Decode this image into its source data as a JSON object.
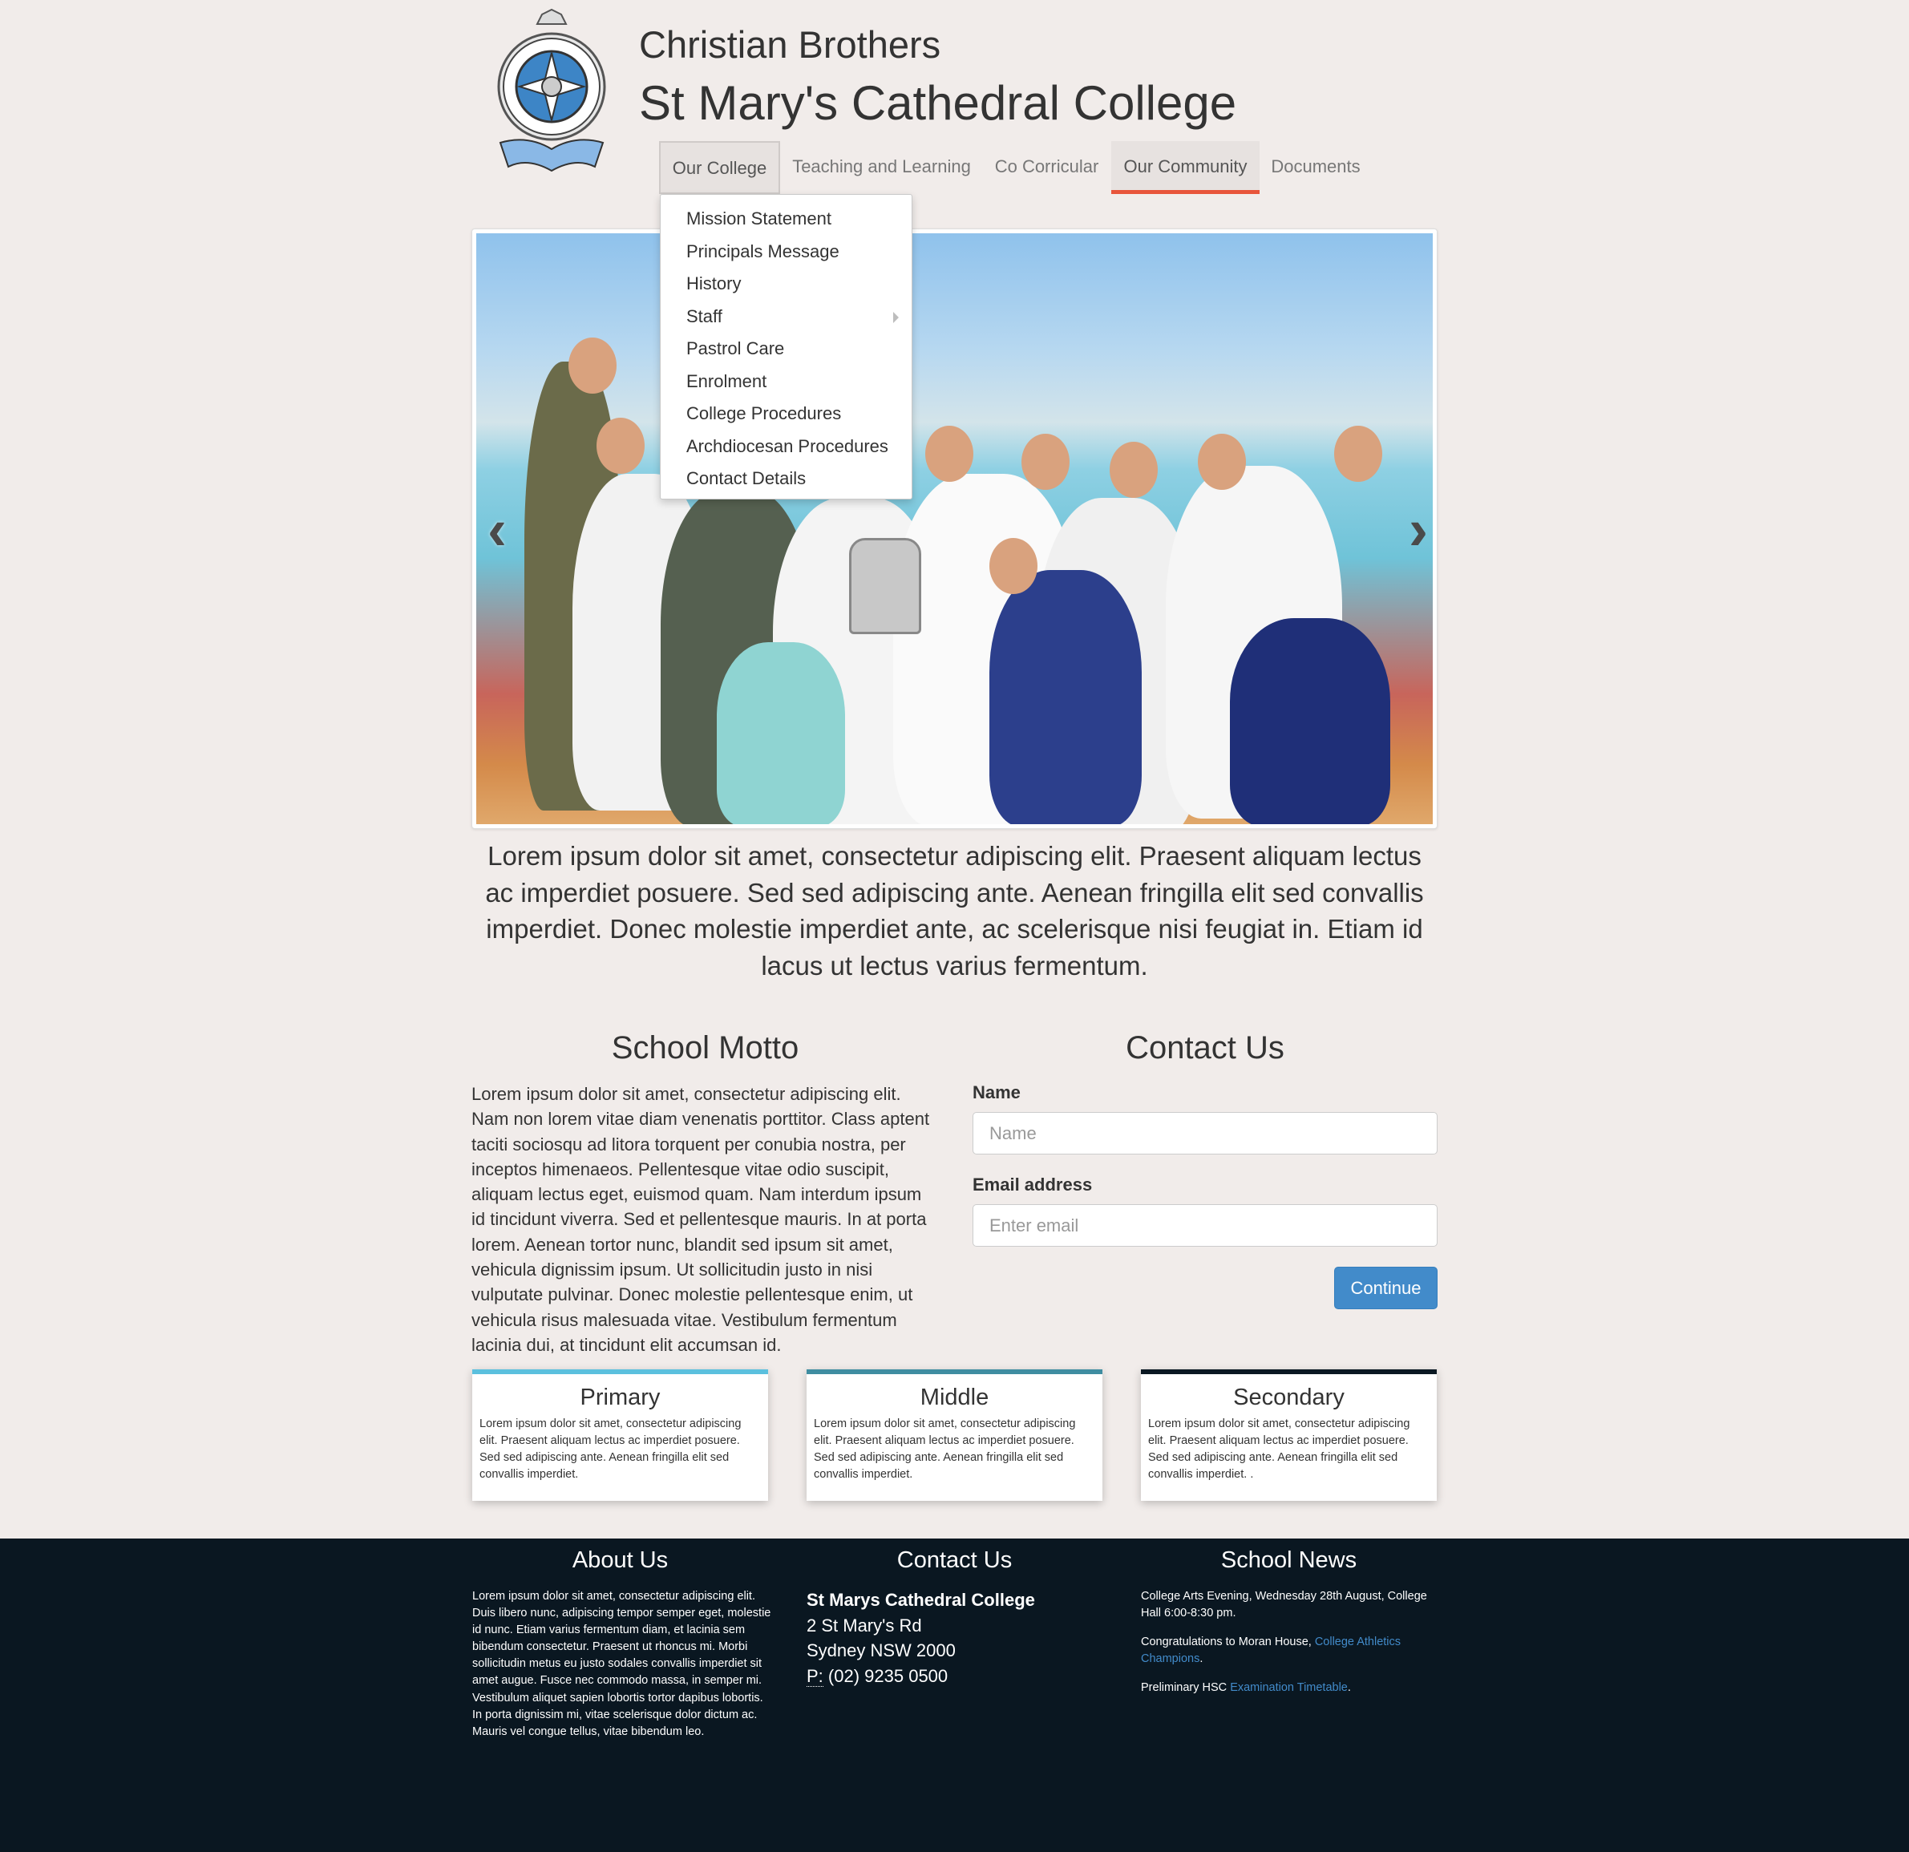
{
  "header": {
    "brand_top": "Christian Brothers",
    "brand_main": "St Mary's Cathedral College",
    "logo_banner": "Cathedral College",
    "logo_ring": "Christian Brothers"
  },
  "nav": {
    "items": [
      {
        "label": "Our College",
        "state": "open"
      },
      {
        "label": "Teaching and Learning"
      },
      {
        "label": "Co Corricular"
      },
      {
        "label": "Our Community",
        "state": "active"
      },
      {
        "label": "Documents"
      }
    ],
    "active_color": "#e8553b"
  },
  "dropdown": {
    "items": [
      {
        "label": "Mission Statement"
      },
      {
        "label": "Principals Message"
      },
      {
        "label": "History"
      },
      {
        "label": "Staff",
        "has_submenu": true
      },
      {
        "label": "Pastrol Care"
      },
      {
        "label": "Enrolment"
      },
      {
        "label": "College Procedures"
      },
      {
        "label": "Archdiocesan Procedures"
      },
      {
        "label": "Contact Details"
      }
    ]
  },
  "carousel": {
    "prev_icon": "chevron-left-icon",
    "next_icon": "chevron-right-icon"
  },
  "lead": "Lorem ipsum dolor sit amet, consectetur adipiscing elit. Praesent aliquam lectus ac imperdiet posuere. Sed sed adipiscing ante. Aenean fringilla elit sed convallis imperdiet. Donec molestie imperdiet ante, ac scelerisque nisi feugiat in. Etiam id lacus ut lectus varius fermentum.",
  "motto": {
    "title": "School Motto",
    "text": "Lorem ipsum dolor sit amet, consectetur adipiscing elit. Nam non lorem vitae diam venenatis porttitor. Class aptent taciti sociosqu ad litora torquent per conubia nostra, per inceptos himenaeos. Pellentesque vitae odio suscipit, aliquam lectus eget, euismod quam. Nam interdum ipsum id tincidunt viverra. Sed et pellentesque mauris. In at porta lorem. Aenean tortor nunc, blandit sed ipsum sit amet, vehicula dignissim ipsum. Ut sollicitudin justo in nisi vulputate pulvinar. Donec molestie pellentesque enim, ut vehicula risus malesuada vitae. Vestibulum fermentum lacinia dui, at tincidunt elit accumsan id."
  },
  "contact_form": {
    "title": "Contact Us",
    "name_label": "Name",
    "name_placeholder": "Name",
    "name_value": "",
    "email_label": "Email address",
    "email_placeholder": "Enter email",
    "email_value": "",
    "submit_label": "Continue",
    "submit_color": "#428bca"
  },
  "cards": [
    {
      "title": "Primary",
      "text": "Lorem ipsum dolor sit amet, consectetur adipiscing elit. Praesent aliquam lectus ac imperdiet posuere. Sed sed adipiscing ante. Aenean fringilla elit sed convallis imperdiet.",
      "accent": "#5bc0de"
    },
    {
      "title": "Middle",
      "text": "Lorem ipsum dolor sit amet, consectetur adipiscing elit. Praesent aliquam lectus ac imperdiet posuere. Sed sed adipiscing ante. Aenean fringilla elit sed convallis imperdiet.",
      "accent": "#3f8da1"
    },
    {
      "title": "Secondary",
      "text": "Lorem ipsum dolor sit amet, consectetur adipiscing elit. Praesent aliquam lectus ac imperdiet posuere. Sed sed adipiscing ante. Aenean fringilla elit sed convallis imperdiet. .",
      "accent": "#0a1823"
    }
  ],
  "footer": {
    "background": "#0a1721",
    "about": {
      "title": "About Us",
      "text": "Lorem ipsum dolor sit amet, consectetur adipiscing elit. Duis libero nunc, adipiscing tempor semper eget, molestie id nunc. Etiam varius fermentum diam, et lacinia sem bibendum consectetur. Praesent ut rhoncus mi. Morbi sollicitudin metus eu justo sodales convallis imperdiet sit amet augue. Fusce nec commodo massa, in semper mi. Vestibulum aliquet sapien lobortis tortor dapibus lobortis. In porta dignissim mi, vitae scelerisque dolor dictum ac. Mauris vel congue tellus, vitae bibendum leo."
    },
    "contact": {
      "title": "Contact Us",
      "name": "St Marys Cathedral College",
      "street": "2 St Mary's Rd",
      "city": "Sydney NSW 2000",
      "phone_label": "P:",
      "phone": "(02) 9235 0500"
    },
    "news": {
      "title": "School News",
      "item1": "College Arts Evening, Wednesday 28th August, College Hall 6:00-8:30 pm.",
      "item2_prefix": "Congratulations to Moran House, ",
      "item2_link": "College Athletics Champions",
      "item2_suffix": ".",
      "item3_prefix": "Preliminary HSC ",
      "item3_link": "Examination Timetable",
      "item3_suffix": ".",
      "link_color": "#428bca"
    }
  }
}
